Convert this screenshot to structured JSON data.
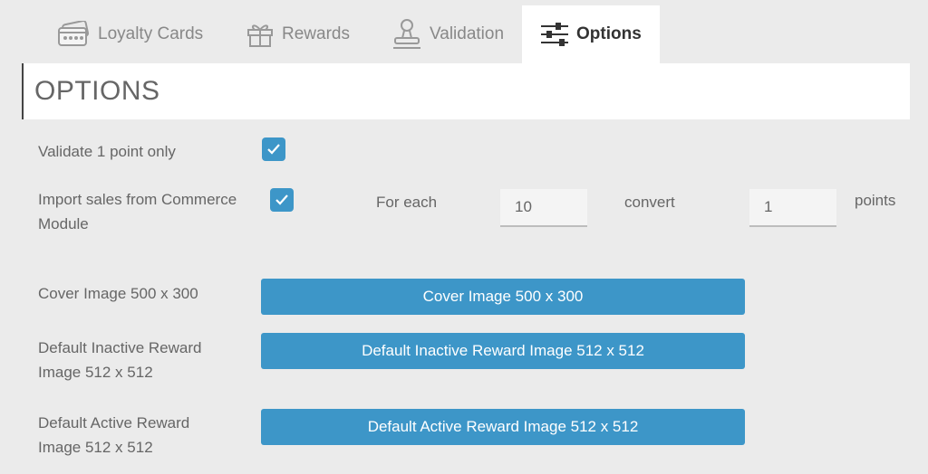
{
  "tabs": [
    {
      "label": "Loyalty Cards",
      "icon": "loyalty-card-icon",
      "active": false
    },
    {
      "label": "Rewards",
      "icon": "gift-icon",
      "active": false
    },
    {
      "label": "Validation",
      "icon": "stamp-icon",
      "active": false
    },
    {
      "label": "Options",
      "icon": "sliders-icon",
      "active": true
    }
  ],
  "header": {
    "title": "OPTIONS"
  },
  "settings": {
    "validate_one_point": {
      "label": "Validate 1 point only",
      "checked": true
    },
    "import_sales": {
      "label_line1": "Import sales from Commerce",
      "label_line2": "Module",
      "checked": true,
      "for_each_label": "For each",
      "for_each_value": "10",
      "convert_label": "convert",
      "convert_value": "1",
      "points_label": "points"
    }
  },
  "images": {
    "cover": {
      "label": "Cover Image 500 x 300",
      "button": "Cover Image 500 x 300"
    },
    "inactive": {
      "label_line1": "Default Inactive Reward",
      "label_line2": "Image 512 x 512",
      "button": "Default Inactive Reward Image 512 x 512"
    },
    "active": {
      "label_line1": "Default Active Reward",
      "label_line2": "Image 512 x 512",
      "button": "Default Active Reward Image 512 x 512"
    }
  },
  "colors": {
    "accent": "#3d96c8",
    "background": "#ebebeb",
    "panel": "#ffffff"
  }
}
